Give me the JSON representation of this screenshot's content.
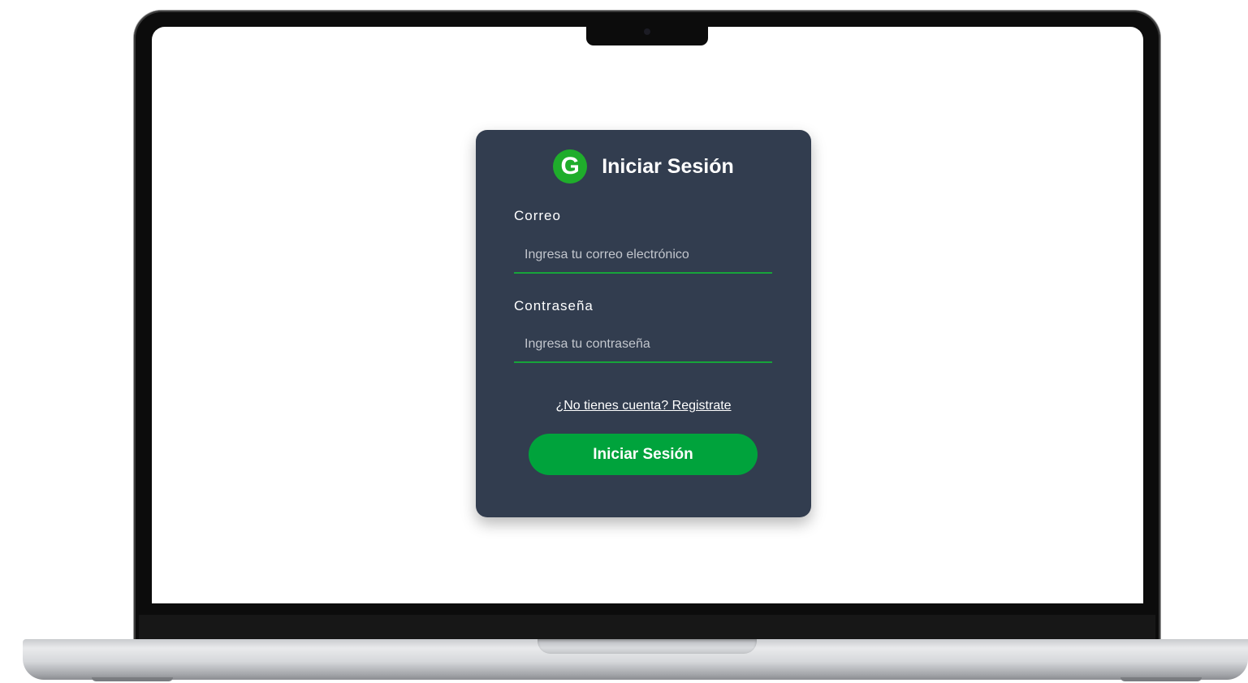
{
  "login": {
    "logo_letter": "G",
    "title": "Iniciar Sesión",
    "email": {
      "label": "Correo",
      "value": "",
      "placeholder": "Ingresa tu correo electrónico"
    },
    "password": {
      "label": "Contraseña",
      "value": "",
      "placeholder": "Ingresa tu contraseña"
    },
    "register_link": "¿No tienes cuenta? Registrate",
    "submit_label": "Iniciar Sesión"
  },
  "colors": {
    "card_background": "#323d4f",
    "accent_green": "#00a33c",
    "logo_green": "#1fad2b",
    "text": "#ffffff"
  }
}
